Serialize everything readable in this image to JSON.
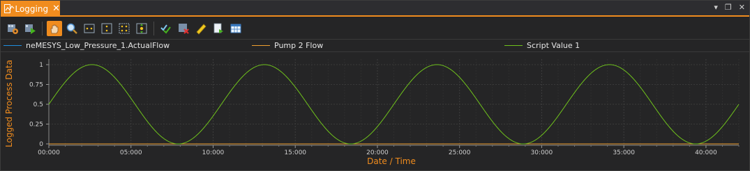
{
  "window": {
    "tab_label": "Logging",
    "tab_close": "✕",
    "menu_glyph": "▾",
    "restore_glyph": "❐",
    "close_glyph": "✕"
  },
  "toolbar": {
    "buttons": [
      {
        "name": "settings-icon",
        "active": false
      },
      {
        "name": "start-logging-icon",
        "active": false
      },
      {
        "name": "pan-hand-icon",
        "active": true
      },
      {
        "name": "zoom-icon",
        "active": false
      },
      {
        "name": "fit-horizontal-icon",
        "active": false
      },
      {
        "name": "fit-vertical-icon",
        "active": false
      },
      {
        "name": "fit-all-icon",
        "active": false
      },
      {
        "name": "center-icon",
        "active": false
      },
      {
        "name": "check-all-icon",
        "active": false
      },
      {
        "name": "clear-icon",
        "active": false
      },
      {
        "name": "ruler-icon",
        "active": false
      },
      {
        "name": "export-icon",
        "active": false
      },
      {
        "name": "table-icon",
        "active": false
      }
    ]
  },
  "legend": [
    {
      "label": "neMESYS_Low_Pressure_1.ActualFlow",
      "color": "#1f8fe0"
    },
    {
      "label": "Pump 2 Flow",
      "color": "#f0a030"
    },
    {
      "label": "Script Value 1",
      "color": "#6fc21c"
    }
  ],
  "colors": {
    "accent": "#f08c1e",
    "background": "#252526",
    "grid": "#3a3a3a"
  },
  "chart_data": {
    "type": "line",
    "ylabel": "Logged Process Data",
    "xlabel": "Date / Time",
    "xlim_seconds": [
      0,
      2520
    ],
    "ylim": [
      0,
      1
    ],
    "x_ticks": [
      "00:000",
      "05:000",
      "10:000",
      "15:000",
      "20:000",
      "25:000",
      "30:000",
      "35:000",
      "40:000"
    ],
    "y_ticks": [
      "0",
      "0.25",
      "0.5",
      "0.75",
      "1"
    ],
    "grid": true,
    "series": [
      {
        "name": "neMESYS_Low_Pressure_1.ActualFlow",
        "color": "#1f8fe0",
        "x_minutes": [
          0,
          42
        ],
        "y": [
          0,
          0
        ]
      },
      {
        "name": "Pump 2 Flow",
        "color": "#f0a030",
        "x_minutes": [
          0,
          42
        ],
        "y": [
          0,
          0
        ]
      },
      {
        "name": "Script Value 1",
        "color": "#6fc21c",
        "function": "sine",
        "period_minutes": 10.5,
        "x_minutes": [
          0,
          42
        ],
        "y_start": 0.5,
        "y_min": 0,
        "y_max": 1
      }
    ]
  }
}
